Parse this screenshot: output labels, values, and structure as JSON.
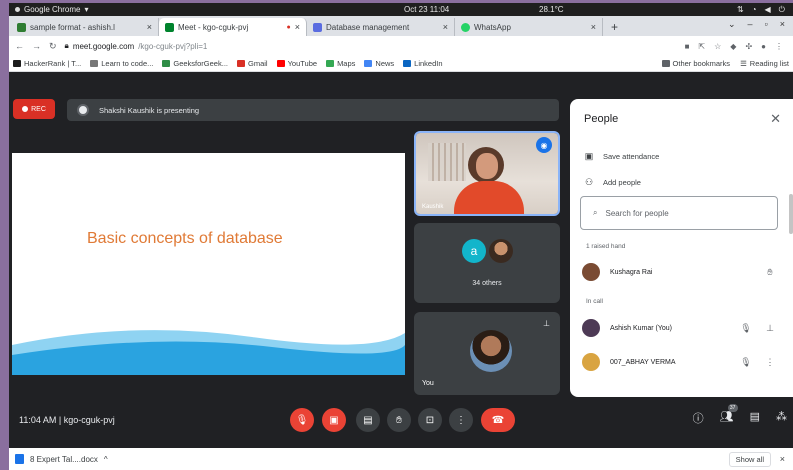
{
  "os": {
    "app_name": "Google Chrome",
    "clock": "Oct 23 11:04",
    "temp": "28.1°C"
  },
  "tabs": [
    {
      "label": "sample format - ashish.l",
      "fav_color": "#2f7d32"
    },
    {
      "label": "Meet - kgo-cguk-pvj",
      "fav_color": "#00832d"
    },
    {
      "label": "Database management",
      "fav_color": "#5a6ce0"
    },
    {
      "label": "WhatsApp",
      "fav_color": "#25d366"
    }
  ],
  "toolbar": {
    "url_host": "meet.google.com",
    "url_path": "/kgo-cguk-pvj?pli=1"
  },
  "bookmarks": [
    {
      "label": "HackerRank | T...",
      "color": "#1c1c1c"
    },
    {
      "label": "Learn to code...",
      "color": "#777"
    },
    {
      "label": "GeeksforGeek...",
      "color": "#2f8d46"
    },
    {
      "label": "Gmail",
      "color": "#d93025"
    },
    {
      "label": "YouTube",
      "color": "#ff0000"
    },
    {
      "label": "Maps",
      "color": "#34a853"
    },
    {
      "label": "News",
      "color": "#4285f4"
    },
    {
      "label": "LinkedIn",
      "color": "#0a66c2"
    }
  ],
  "bookmarks_right": {
    "other": "Other bookmarks",
    "reading": "Reading list"
  },
  "meet": {
    "rec_label": "REC",
    "presenting_text": "Shakshi Kaushik is presenting",
    "slide_title": "Basic concepts of database",
    "tile1_name": "Kaushik",
    "others_avatar_letter": "a",
    "others_count": "34 others",
    "self_label": "You",
    "meeting_info": "11:04 AM  |  kgo-cguk-pvj",
    "participants_badge": "37"
  },
  "people": {
    "title": "People",
    "save_attendance": "Save attendance",
    "add_people": "Add people",
    "search_placeholder": "Search for people",
    "raised_section": "1 raised hand",
    "in_call_section": "In call",
    "raised": [
      {
        "name": "Kushagra Rai",
        "avatar_color": "#7a4b33"
      }
    ],
    "in_call": [
      {
        "name": "Ashish Kumar (You)",
        "avatar_color": "#4d3a55"
      },
      {
        "name": "007_ABHAY VERMA",
        "avatar_color": "#d9a441"
      }
    ]
  },
  "download": {
    "file": "8 Expert Tal....docx",
    "show_all": "Show all"
  }
}
